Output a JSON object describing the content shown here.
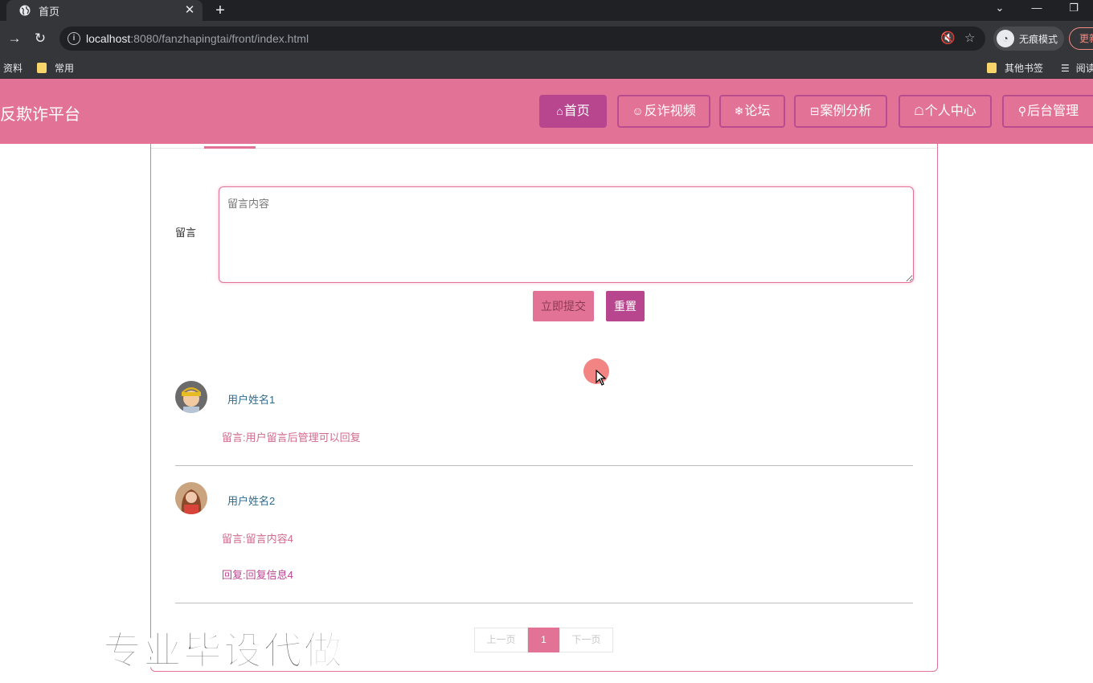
{
  "browser": {
    "tab_title": "首页",
    "url_host": "localhost",
    "url_rest": ":8080/fanzhapingtai/front/index.html",
    "incognito_label": "无痕模式",
    "update_label": "更新",
    "bookmarks": {
      "left_item": "资料",
      "common_folder": "常用",
      "other_folder": "其他书签",
      "reading_list": "阅读"
    }
  },
  "header": {
    "logo": "反欺诈平台",
    "nav": [
      {
        "icon": "⌂",
        "label": "首页"
      },
      {
        "icon": "☺",
        "label": "反诈视频"
      },
      {
        "icon": "❄",
        "label": "论坛"
      },
      {
        "icon": "⊟",
        "label": "案例分析"
      },
      {
        "icon": "☖",
        "label": "个人中心"
      },
      {
        "icon": "⚲",
        "label": "后台管理"
      }
    ]
  },
  "form": {
    "label": "留言",
    "placeholder": "留言内容",
    "submit_label": "立即提交",
    "reset_label": "重置"
  },
  "messages": [
    {
      "username": "用户姓名1",
      "content": "留言:用户留言后管理可以回复"
    },
    {
      "username": "用户姓名2",
      "content": "留言:留言内容4",
      "reply": "回复:回复信息4"
    }
  ],
  "pagination": {
    "prev": "上一页",
    "current": "1",
    "next": "下一页"
  },
  "watermark": "专业毕设代做",
  "colors": {
    "primary": "#e27396",
    "accent": "#b8468f"
  }
}
